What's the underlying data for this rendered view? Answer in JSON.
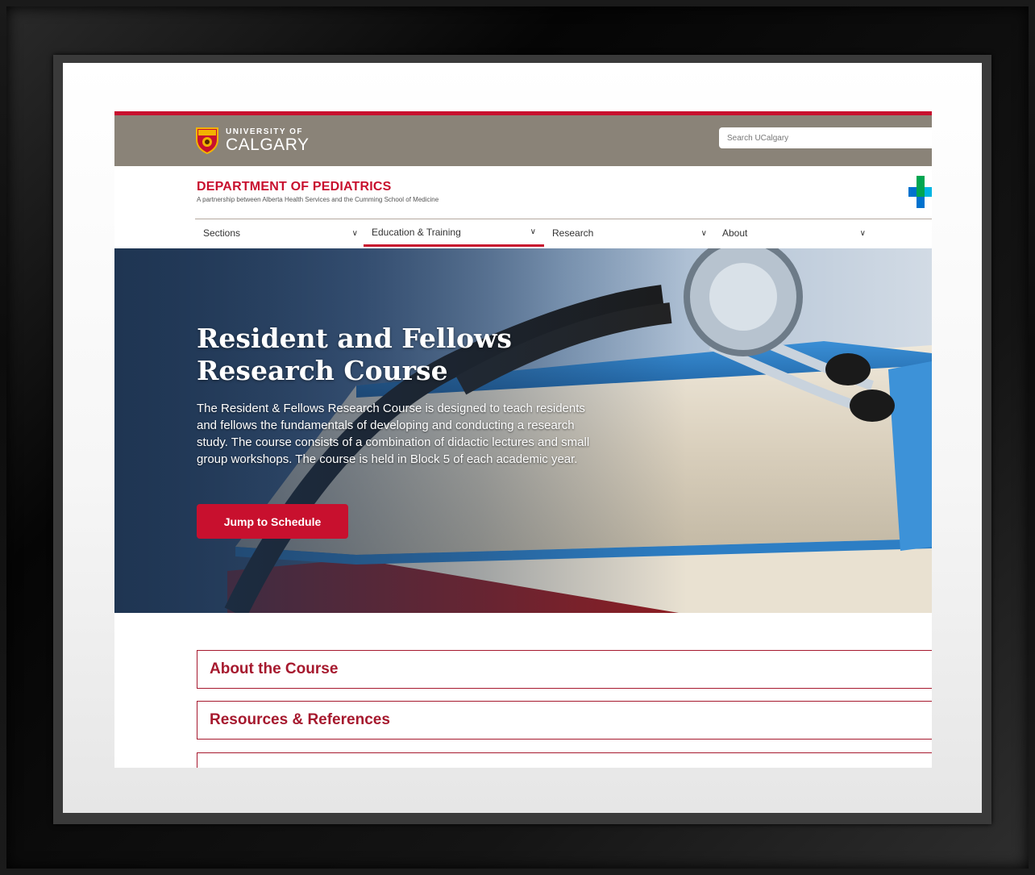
{
  "header": {
    "logo_small": "UNIVERSITY OF",
    "logo_big": "CALGARY",
    "search_placeholder": "Search UCalgary"
  },
  "department": {
    "title": "DEPARTMENT OF PEDIATRICS",
    "subtitle": "A partnership between Alberta Health Services and the Cumming School of Medicine"
  },
  "nav": {
    "items": [
      {
        "label": "Sections"
      },
      {
        "label": "Education & Training"
      },
      {
        "label": "Research"
      },
      {
        "label": "About"
      }
    ],
    "active_index": 1
  },
  "hero": {
    "title": "Resident and Fellows Research Course",
    "description": "The Resident & Fellows Research Course is designed to teach residents and fellows the fundamentals of developing and conducting a research study.  The course consists of a combination of didactic lectures and small group workshops. The course is held in Block 5 of each academic year.",
    "button_label": "Jump to Schedule"
  },
  "accordion": {
    "items": [
      {
        "label": "About the Course"
      },
      {
        "label": "Resources & References"
      }
    ]
  },
  "colors": {
    "brand_red": "#c8102e",
    "header_taupe": "#8a8378"
  }
}
